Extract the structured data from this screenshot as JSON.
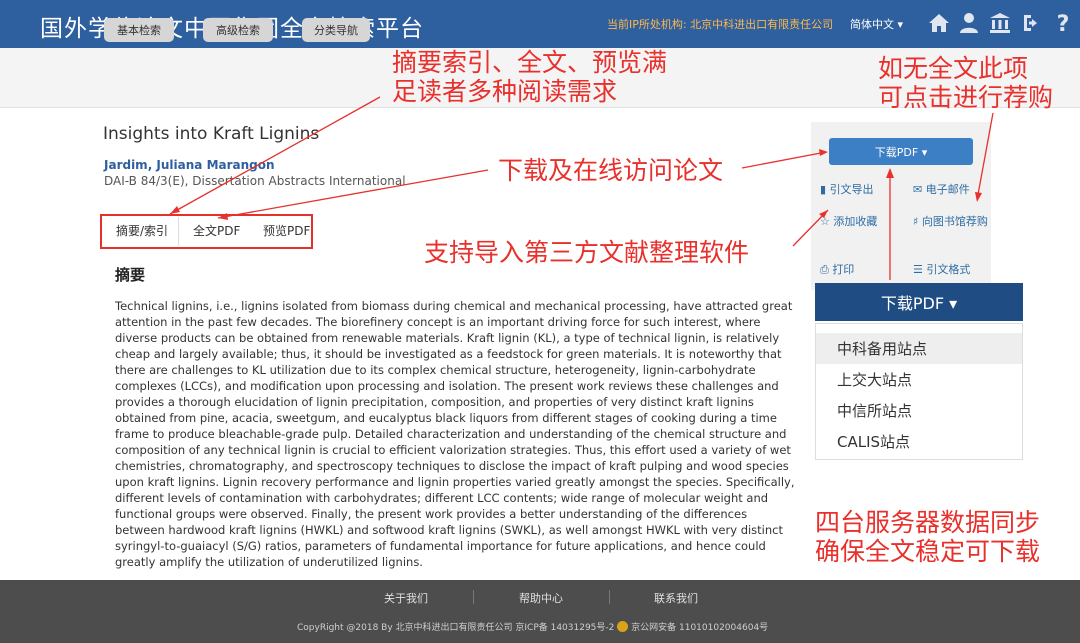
{
  "header": {
    "site_title": "国外学位论文中国集团全文检索平台",
    "ip_info": "当前IP所处机构: 北京中科进出口有限责任公司",
    "language": "简体中文 ▾",
    "icons": [
      "home-icon",
      "user-icon",
      "institution-icon",
      "sign-out-icon",
      "help-icon"
    ]
  },
  "nav": {
    "basic_search": "基本检索",
    "advanced_search": "高级检索",
    "category_nav": "分类导航"
  },
  "article": {
    "title": "Insights into Kraft Lignins",
    "author": "Jardim, Juliana Marangon",
    "citation": "DAI-B 84/3(E), Dissertation Abstracts International"
  },
  "tabs": {
    "abstract": "摘要/索引",
    "fulltext": "全文PDF",
    "preview": "预览PDF"
  },
  "abstract": {
    "heading": "摘要",
    "text": "Technical lignins, i.e., lignins isolated from biomass during chemical and mechanical processing, have attracted great attention in the past few decades. The biorefinery concept is an important driving force for such interest, where diverse products can be obtained from renewable materials. Kraft lignin (KL), a type of technical lignin, is relatively cheap and largely available; thus, it should be investigated as a feedstock for green materials. It is noteworthy that there are challenges to KL utilization due to its complex chemical structure, heterogeneity, lignin-carbohydrate complexes (LCCs), and modification upon processing and isolation. The present work reviews these challenges and provides a thorough elucidation of lignin precipitation, composition, and properties of very distinct kraft lignins obtained from pine, acacia, sweetgum, and eucalyptus black liquors from different stages of cooking during a time frame to produce bleachable-grade pulp. Detailed characterization and understanding of the chemical structure and composition of any technical lignin is crucial to efficient valorization strategies. Thus, this effort used a variety of wet chemistries, chromatography, and spectroscopy techniques to disclose the impact of kraft pulping and wood species upon kraft lignins. Lignin recovery performance and lignin properties varied greatly amongst the species. Specifically, different levels of contamination with carbohydrates; different LCC contents; wide range of molecular weight and functional groups were observed. Finally, the present work provides a better understanding of the differences between hardwood kraft lignins (HWKL) and softwood kraft lignins (SWKL), as well amongst HWKL with very distinct syringyl-to-guaiacyl (S/G) ratios, parameters of fundamental importance for future applications, and hence could greatly amplify the utilization of underutilized lignins."
  },
  "sidebar": {
    "download_pdf": "下载PDF ▾",
    "export_citation": "引文导出",
    "email": "电子邮件",
    "add_favorite": "添加收藏",
    "recommend_library": "向图书馆荐购",
    "print": "打印",
    "citation_format": "引文格式"
  },
  "dropdown": {
    "header": "下载PDF ▾",
    "items": [
      "中科备用站点",
      "上交大站点",
      "中信所站点",
      "CALIS站点"
    ]
  },
  "annotations": {
    "abstract_fulltext": [
      "摘要索引、全文、预览满",
      "足读者多种阅读需求"
    ],
    "recommend": [
      "如无全文此项",
      "可点击进行荐购"
    ],
    "download_online": "下载及在线访问论文",
    "import_third_party": "支持导入第三方文献整理软件",
    "four_servers": [
      "四台服务器数据同步",
      "确保全文稳定可下载"
    ]
  },
  "footer": {
    "about": "关于我们",
    "help": "帮助中心",
    "contact": "联系我们",
    "copyright_left": "CopyRight @2018 By 北京中科进出口有限责任公司 京ICP备 14031295号-2",
    "copyright_right": "京公网安备 11010102004604号"
  },
  "colors": {
    "header_blue": "#2e5f9e",
    "annotation_red": "#e8302c",
    "button_blue": "#3d7fc4"
  }
}
